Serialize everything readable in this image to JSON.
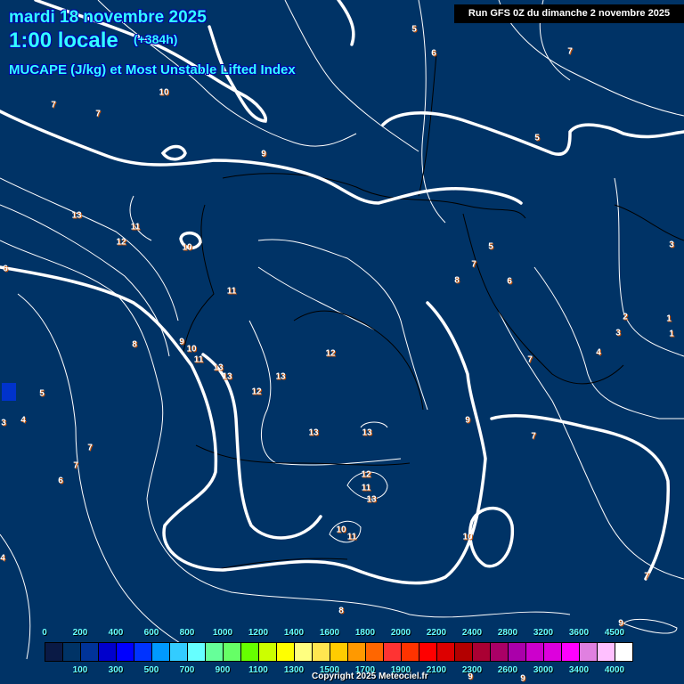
{
  "header": {
    "date": "mardi 18 novembre 2025",
    "time": "1:00 locale",
    "lead": "(+384h)",
    "parameter": "MUCAPE (J/kg) et Most Unstable Lifted Index",
    "run": "Run GFS 0Z du dimanche 2 novembre 2025"
  },
  "map": {
    "background_color": "#003366",
    "lifted_index_labels": [
      "5",
      "6",
      "7",
      "10",
      "7",
      "7",
      "5",
      "9",
      "13",
      "11",
      "12",
      "10",
      "5",
      "3",
      "6",
      "7",
      "6",
      "8",
      "11",
      "2",
      "1",
      "3",
      "1",
      "8",
      "9",
      "10",
      "11",
      "12",
      "4",
      "7",
      "13",
      "13",
      "13",
      "5",
      "12",
      "3",
      "4",
      "9",
      "13",
      "13",
      "7",
      "7",
      "7",
      "12",
      "6",
      "11",
      "13",
      "10",
      "11",
      "10",
      "4",
      "7",
      "8",
      "9",
      "9",
      "9"
    ]
  },
  "legend": {
    "colors": [
      "#0a1a45",
      "#003366",
      "#003399",
      "#0000cc",
      "#0000ff",
      "#0033ff",
      "#0099ff",
      "#33ccff",
      "#66ffff",
      "#66ff99",
      "#66ff66",
      "#66ff00",
      "#ccff00",
      "#ffff00",
      "#ffff80",
      "#ffe650",
      "#ffcc00",
      "#ff9900",
      "#ff6600",
      "#ff3333",
      "#ff3300",
      "#ff0000",
      "#dd0000",
      "#b30000",
      "#aa0033",
      "#aa0066",
      "#aa00aa",
      "#cc00cc",
      "#dd00dd",
      "#ff00ff",
      "#e080e0",
      "#ffc0ff",
      "#ffffff"
    ],
    "top_labels": [
      "0",
      "200",
      "400",
      "600",
      "800",
      "1000",
      "1200",
      "1400",
      "1600",
      "1800",
      "2000",
      "2200",
      "2400",
      "2800",
      "3200",
      "3600",
      "4500"
    ],
    "bottom_labels": [
      "100",
      "300",
      "500",
      "700",
      "900",
      "1100",
      "1300",
      "1500",
      "1700",
      "1900",
      "2100",
      "2300",
      "2600",
      "3000",
      "3400",
      "4000"
    ]
  },
  "footer": {
    "copyright": "Copyright 2025 Meteociel.fr"
  }
}
